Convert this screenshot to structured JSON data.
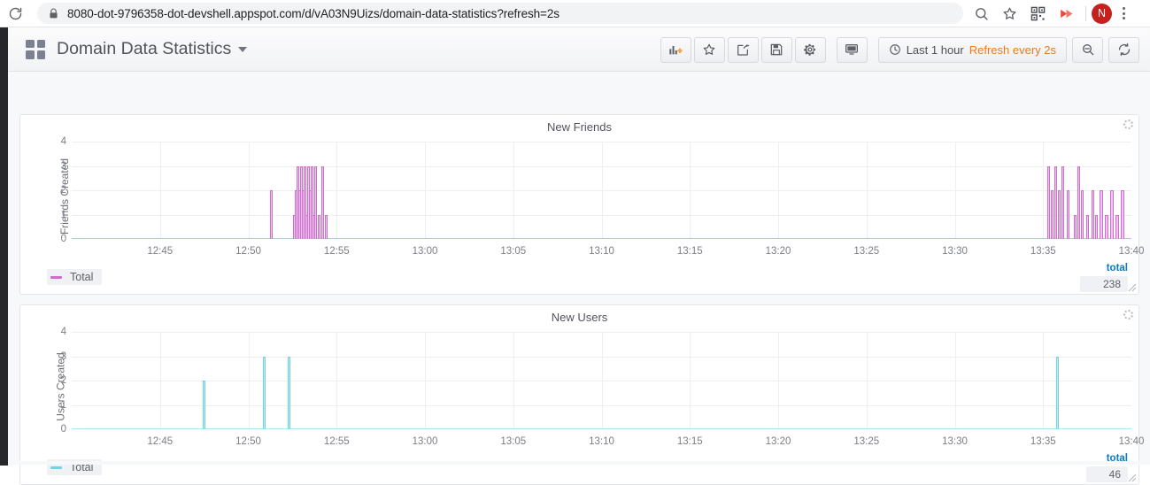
{
  "browser": {
    "url": "8080-dot-9796358-dot-devshell.appspot.com/d/vA03N9Uizs/domain-data-statistics?refresh=2s",
    "reload_icon": "reload-icon",
    "lock_icon": "lock-icon",
    "actions": [
      {
        "name": "zoom-search-icon",
        "label": ""
      },
      {
        "name": "bookmark-star-icon",
        "label": ""
      },
      {
        "name": "qr-code-icon",
        "label": ""
      },
      {
        "name": "extension-icon",
        "label": ""
      }
    ],
    "profile_initial": "N",
    "menu_icon": "kebab-menu-icon"
  },
  "navbar": {
    "dashboard_icon": "dashboard-grid-icon",
    "title": "Domain Data Statistics",
    "caret_icon": "chevron-down-icon",
    "buttons": [
      {
        "name": "add-panel-button",
        "icon": "add-panel-icon",
        "tooltip": "Add panel"
      },
      {
        "name": "mark-favorite-button",
        "icon": "star-icon",
        "tooltip": "Mark as favorite"
      },
      {
        "name": "share-dashboard-button",
        "icon": "share-icon",
        "tooltip": "Share dashboard"
      },
      {
        "name": "save-dashboard-button",
        "icon": "save-floppy-icon",
        "tooltip": "Save dashboard"
      },
      {
        "name": "dashboard-settings-button",
        "icon": "gear-icon",
        "tooltip": "Settings"
      }
    ],
    "kiosk_button": {
      "name": "cycle-view-mode-button",
      "icon": "monitor-icon"
    },
    "time_picker": {
      "clock_icon": "clock-icon",
      "range_label": "Last 1 hour",
      "refresh_label": "Refresh every 2s"
    },
    "zoom_out_button": {
      "name": "zoom-out-time-button",
      "icon": "zoom-out-icon"
    },
    "refresh_button": {
      "name": "refresh-button",
      "icon": "refresh-icon"
    }
  },
  "colors": {
    "friends_line": "#cf6ccf",
    "friends_fill": "#ecc6ec",
    "users_line": "#6fd2e6",
    "users_fill": "#bfe9f3",
    "accent_orange": "#eb7b18",
    "link_blue": "#0a7bbf"
  },
  "panels": [
    {
      "id": "new-friends",
      "title": "New Friends",
      "legend": {
        "series_label": "Total",
        "stat_header": "total",
        "stat_value": "238"
      }
    },
    {
      "id": "new-users",
      "title": "New Users",
      "legend": {
        "series_label": "Total",
        "stat_header": "total",
        "stat_value": "46"
      }
    }
  ],
  "chart_data": [
    {
      "id": "new-friends",
      "type": "bar",
      "title": "New Friends",
      "xlabel": "",
      "ylabel": "Friends Created",
      "ylim": [
        0,
        4
      ],
      "yticks": [
        0,
        1,
        2,
        3,
        4
      ],
      "xticks": [
        "12:45",
        "12:50",
        "12:55",
        "13:00",
        "13:05",
        "13:10",
        "13:15",
        "13:20",
        "13:25",
        "13:30",
        "13:35",
        "13:40"
      ],
      "x_range": [
        "12:40",
        "13:40"
      ],
      "grid": true,
      "legend": {
        "position": "bottom",
        "entries": [
          "Total"
        ]
      },
      "series": [
        {
          "name": "Total",
          "color": "#cf6ccf",
          "total": 238,
          "points": [
            {
              "t": "12:51.3",
              "v": 2
            },
            {
              "t": "12:52.6",
              "v": 1
            },
            {
              "t": "12:52.7",
              "v": 2
            },
            {
              "t": "12:52.8",
              "v": 3
            },
            {
              "t": "12:52.9",
              "v": 2
            },
            {
              "t": "12:53.0",
              "v": 3
            },
            {
              "t": "12:53.1",
              "v": 2
            },
            {
              "t": "12:53.2",
              "v": 3
            },
            {
              "t": "12:53.3",
              "v": 1
            },
            {
              "t": "12:53.4",
              "v": 3
            },
            {
              "t": "12:53.5",
              "v": 2
            },
            {
              "t": "12:53.6",
              "v": 3
            },
            {
              "t": "12:53.7",
              "v": 1
            },
            {
              "t": "12:53.8",
              "v": 3
            },
            {
              "t": "12:54.0",
              "v": 1
            },
            {
              "t": "12:54.2",
              "v": 3
            },
            {
              "t": "12:54.4",
              "v": 1
            },
            {
              "t": "13:35.3",
              "v": 3
            },
            {
              "t": "13:35.5",
              "v": 2
            },
            {
              "t": "13:35.7",
              "v": 3
            },
            {
              "t": "13:35.9",
              "v": 2
            },
            {
              "t": "13:36.1",
              "v": 3
            },
            {
              "t": "13:36.4",
              "v": 2
            },
            {
              "t": "13:36.8",
              "v": 1
            },
            {
              "t": "13:37.0",
              "v": 3
            },
            {
              "t": "13:37.2",
              "v": 2
            },
            {
              "t": "13:37.5",
              "v": 1
            },
            {
              "t": "13:37.8",
              "v": 2
            },
            {
              "t": "13:38.0",
              "v": 1
            },
            {
              "t": "13:38.3",
              "v": 2
            },
            {
              "t": "13:38.6",
              "v": 1
            },
            {
              "t": "13:38.9",
              "v": 2
            },
            {
              "t": "13:39.2",
              "v": 1
            },
            {
              "t": "13:39.5",
              "v": 2
            }
          ]
        }
      ]
    },
    {
      "id": "new-users",
      "type": "bar",
      "title": "New Users",
      "xlabel": "",
      "ylabel": "Users Created",
      "ylim": [
        0,
        4
      ],
      "yticks": [
        0,
        1,
        2,
        3,
        4
      ],
      "xticks": [
        "12:45",
        "12:50",
        "12:55",
        "13:00",
        "13:05",
        "13:10",
        "13:15",
        "13:20",
        "13:25",
        "13:30",
        "13:35",
        "13:40"
      ],
      "x_range": [
        "12:40",
        "13:40"
      ],
      "grid": true,
      "legend": {
        "position": "bottom",
        "entries": [
          "Total"
        ]
      },
      "series": [
        {
          "name": "Total",
          "color": "#6fd2e6",
          "total": 46,
          "points": [
            {
              "t": "12:47.5",
              "v": 2
            },
            {
              "t": "12:50.9",
              "v": 3
            },
            {
              "t": "12:52.3",
              "v": 3
            },
            {
              "t": "13:35.8",
              "v": 3
            }
          ]
        }
      ]
    }
  ]
}
